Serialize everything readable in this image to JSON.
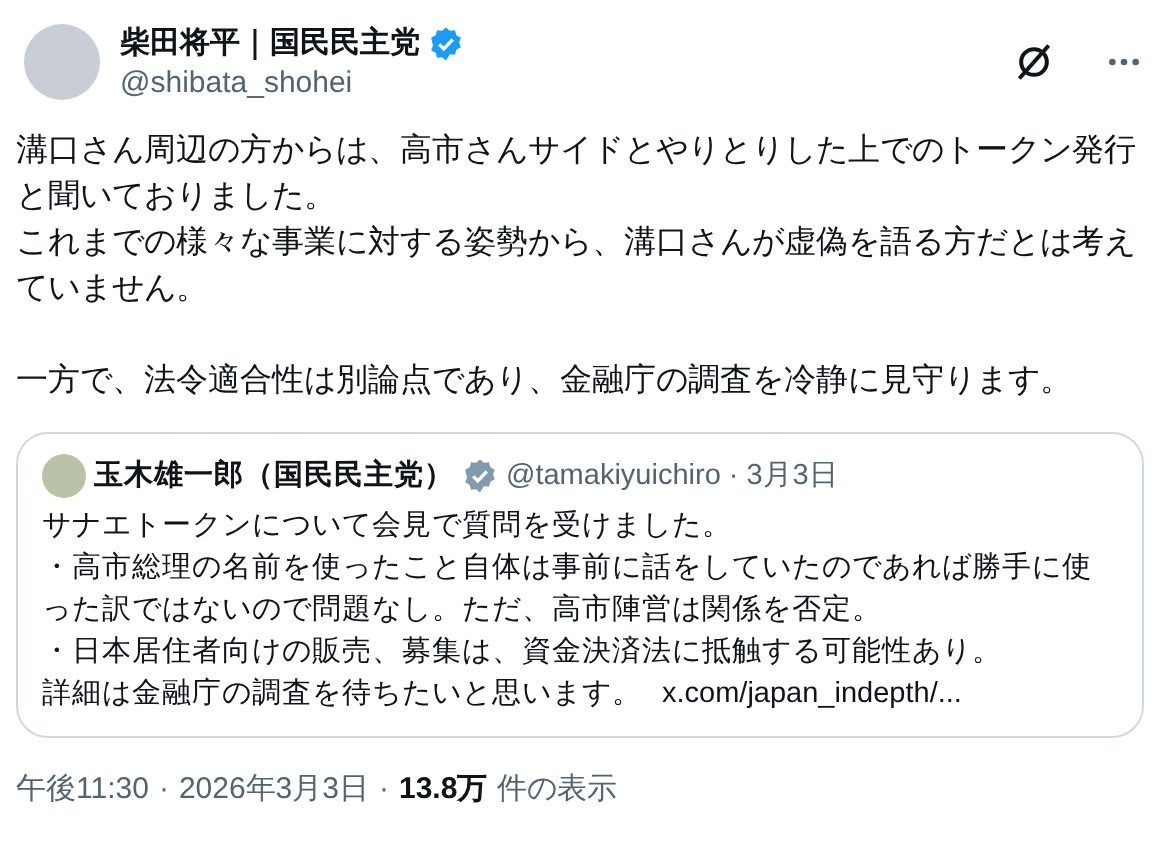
{
  "author": {
    "name": "柴田将平｜国民民主党",
    "handle": "@shibata_shohei",
    "verified": true
  },
  "body": [
    [
      "溝口さん周辺の方からは、高市さんサイドとやりとりした上でのトークン発行と聞いておりました。",
      "これまでの様々な事業に対する姿勢から、溝口さんが虚偽を語る方だとは考えていません。"
    ],
    [
      "一方で、法令適合性は別論点であり、金融庁の調査を冷静に見守ります。"
    ]
  ],
  "quote": {
    "name": "玉木雄一郎（国民民主党）",
    "verified": true,
    "handle": "@tamakiyuichiro",
    "separator": "·",
    "date": "3月3日",
    "lines": [
      "サナエトークンについて会見で質問を受けました。",
      "・高市総理の名前を使ったこと自体は事前に話をしていたのであれば勝手に使った訳ではないので問題なし。ただ、高市陣営は関係を否定。",
      "・日本居住者向けの販売、募集は、資金決済法に抵触する可能性あり。",
      "詳細は金融庁の調査を待ちたいと思います。"
    ],
    "link": "x.com/japan_indepth/..."
  },
  "footer": {
    "time": "午後11:30",
    "dot1": "·",
    "date": "2026年3月3日",
    "dot2": "·",
    "views": "13.8万",
    "views_label": "件の表示"
  }
}
